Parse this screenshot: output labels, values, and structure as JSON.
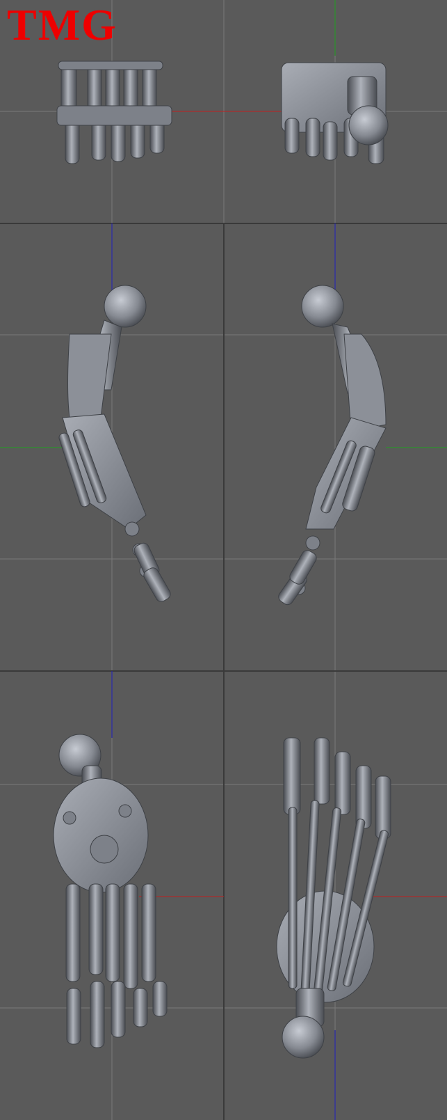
{
  "logo": {
    "text": "TMG",
    "color": "#ee0000"
  },
  "colors": {
    "background": "#5a5a5a",
    "grid_line": "#7a7a7a",
    "panel_border": "#3a3a3a",
    "axis_x": "#c02020",
    "axis_y": "#20a020",
    "axis_z": "#2020c0",
    "model_light": "#b8bcc4",
    "model_mid": "#878b93",
    "model_dark": "#4a4d53"
  },
  "viewports": [
    {
      "name": "top-view",
      "subject": "robot-arm-top-view"
    },
    {
      "name": "front-view",
      "subject": "robot-arm-front-view"
    },
    {
      "name": "side-view",
      "subject": "robot-arm-side-view"
    }
  ]
}
